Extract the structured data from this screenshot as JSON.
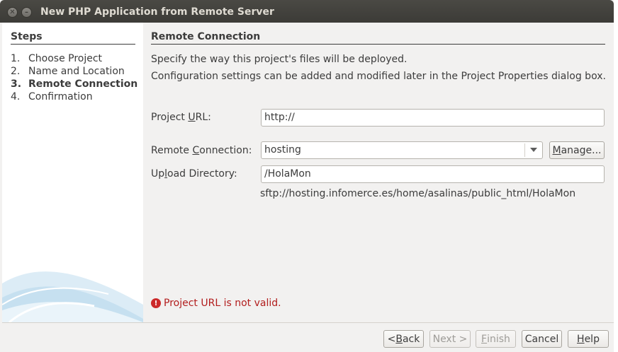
{
  "window": {
    "title": "New PHP Application from Remote Server",
    "close_icon": "close-icon",
    "minimize_icon": "minimize-icon"
  },
  "steps": {
    "title": "Steps",
    "items": [
      {
        "num": "1.",
        "label": "Choose Project"
      },
      {
        "num": "2.",
        "label": "Name and Location"
      },
      {
        "num": "3.",
        "label": "Remote Connection",
        "active": true
      },
      {
        "num": "4.",
        "label": "Confirmation"
      }
    ]
  },
  "main": {
    "title": "Remote Connection",
    "description_1": "Specify the way this project's files will be deployed.",
    "description_2": "Configuration settings can be added and modified later in the Project Properties dialog box.",
    "project_url": {
      "label_pre": "Project ",
      "label_mnemonic": "U",
      "label_post": "RL:",
      "value": "http://"
    },
    "remote_connection": {
      "label_pre": "Remote ",
      "label_mnemonic": "C",
      "label_post": "onnection:",
      "value": "hosting",
      "manage_mnemonic": "M",
      "manage_rest": "anage..."
    },
    "upload_directory": {
      "label_pre": "Up",
      "label_mnemonic": "l",
      "label_post": "oad Directory:",
      "value": "/HolaMon"
    },
    "sftp_path": "sftp://hosting.infomerce.es/home/asalinas/public_html/HolaMon",
    "error": {
      "icon": "error-icon",
      "text": "Project URL is not valid."
    }
  },
  "buttons": {
    "back": {
      "pre": "< ",
      "mnemonic": "B",
      "post": "ack"
    },
    "next": {
      "label": "Next >"
    },
    "finish": {
      "mnemonic": "F",
      "post": "inish"
    },
    "cancel": {
      "label": "Cancel"
    },
    "help": {
      "mnemonic": "H",
      "post": "elp"
    }
  },
  "colors": {
    "title_bar": "#3c3b37",
    "error_text": "#b21d1d",
    "background": "#f2f1f0"
  }
}
